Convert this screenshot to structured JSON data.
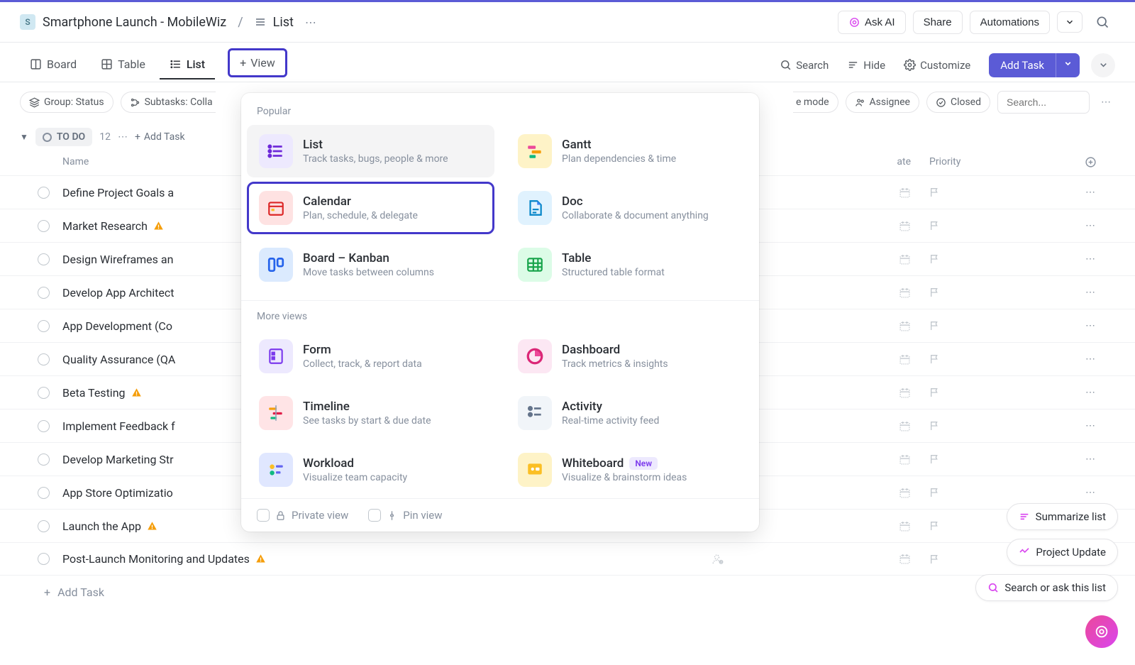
{
  "topbar": {
    "project_initial": "S",
    "project_name": "Smartphone Launch - MobileWiz",
    "current_view": "List",
    "ask_ai": "Ask AI",
    "share": "Share",
    "automations": "Automations"
  },
  "viewbar": {
    "tabs": [
      {
        "label": "Board"
      },
      {
        "label": "Table"
      },
      {
        "label": "List"
      }
    ],
    "add_view": "View",
    "search": "Search",
    "hide": "Hide",
    "customize": "Customize",
    "add_task": "Add Task"
  },
  "filterbar": {
    "group": "Group: Status",
    "subtasks": "Subtasks: Colla",
    "mode_suffix": "e mode",
    "assignee": "Assignee",
    "closed": "Closed",
    "search_placeholder": "Search..."
  },
  "status": {
    "label": "TO DO",
    "count": "12",
    "add_task": "Add Task"
  },
  "columns": {
    "name": "Name",
    "date_suffix": "ate",
    "priority": "Priority"
  },
  "tasks": [
    {
      "name": "Define Project Goals a",
      "warn": false
    },
    {
      "name": "Market Research",
      "warn": true
    },
    {
      "name": "Design Wireframes an",
      "warn": false
    },
    {
      "name": "Develop App Architect",
      "warn": false
    },
    {
      "name": "App Development (Co",
      "warn": false
    },
    {
      "name": "Quality Assurance (QA",
      "warn": false
    },
    {
      "name": "Beta Testing",
      "warn": true
    },
    {
      "name": "Implement Feedback f",
      "warn": false
    },
    {
      "name": "Develop Marketing Str",
      "warn": false
    },
    {
      "name": "App Store Optimizatio",
      "warn": false
    },
    {
      "name": "Launch the App",
      "warn": true
    },
    {
      "name": "Post-Launch Monitoring and Updates",
      "warn": true
    }
  ],
  "add_task_row": "Add Task",
  "popover": {
    "section_popular": "Popular",
    "section_more": "More views",
    "items_popular": [
      {
        "title": "List",
        "desc": "Track tasks, bugs, people & more",
        "cls": "pi-list"
      },
      {
        "title": "Gantt",
        "desc": "Plan dependencies & time",
        "cls": "pi-gantt"
      },
      {
        "title": "Calendar",
        "desc": "Plan, schedule, & delegate",
        "cls": "pi-cal"
      },
      {
        "title": "Doc",
        "desc": "Collaborate & document anything",
        "cls": "pi-doc"
      },
      {
        "title": "Board – Kanban",
        "desc": "Move tasks between columns",
        "cls": "pi-board"
      },
      {
        "title": "Table",
        "desc": "Structured table format",
        "cls": "pi-table"
      }
    ],
    "items_more": [
      {
        "title": "Form",
        "desc": "Collect, track, & report data",
        "cls": "pi-form"
      },
      {
        "title": "Dashboard",
        "desc": "Track metrics & insights",
        "cls": "pi-dashboard"
      },
      {
        "title": "Timeline",
        "desc": "See tasks by start & due date",
        "cls": "pi-timeline"
      },
      {
        "title": "Activity",
        "desc": "Real-time activity feed",
        "cls": "pi-activity"
      },
      {
        "title": "Workload",
        "desc": "Visualize team capacity",
        "cls": "pi-workload"
      },
      {
        "title": "Whiteboard",
        "desc": "Visualize & brainstorm ideas",
        "cls": "pi-whiteboard",
        "badge": "New"
      }
    ],
    "footer_private": "Private view",
    "footer_pin": "Pin view"
  },
  "floating": {
    "summarize": "Summarize list",
    "project_update": "Project Update",
    "search_ask": "Search or ask this list"
  }
}
